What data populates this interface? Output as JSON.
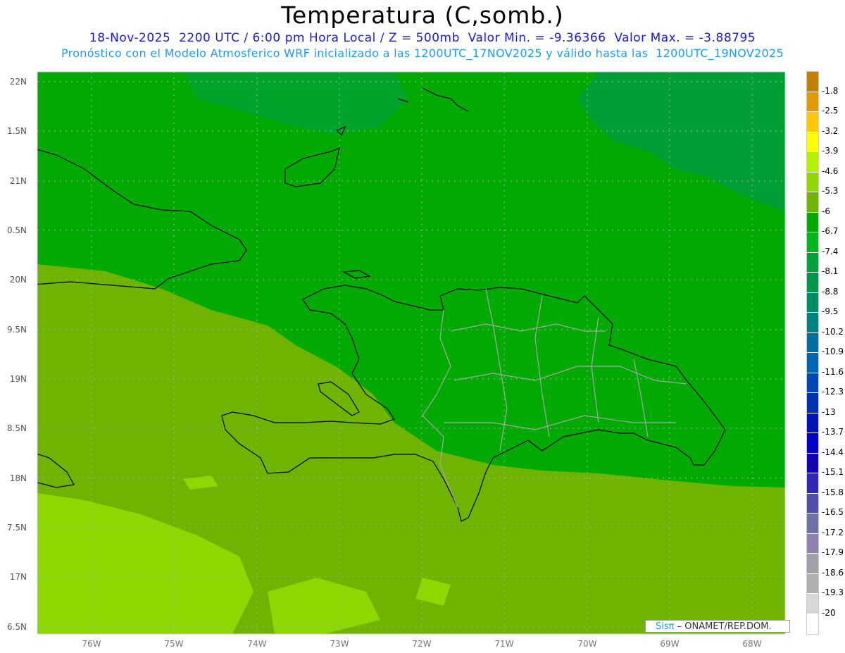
{
  "title": "Temperatura (C,somb.)",
  "subtitle_line1": "18-Nov-2025  2200 UTC / 6:00 pm Hora Local / Z = 500mb  Valor Min. = -9.36366  Valor Max. = -3.88795",
  "subtitle_line2": "Pronóstico con el Modelo Atmosferico WRF inicializado a las 1200UTC_17NOV2025 y válido hasta las  1200UTC_19NOV2025",
  "lat_labels": [
    "22N",
    "1.5N",
    "21N",
    "0.5N",
    "20N",
    "9.5N",
    "19N",
    "8.5N",
    "18N",
    "7.5N",
    "17N",
    "6.5N"
  ],
  "lon_labels": [
    "76W",
    "75W",
    "74W",
    "73W",
    "72W",
    "71W",
    "70W",
    "69W",
    "68W"
  ],
  "colorbar": {
    "labels": [
      "-1.8",
      "-2.5",
      "-3.2",
      "-3.9",
      "-4.6",
      "-5.3",
      "-6",
      "-6.7",
      "-7.4",
      "-8.1",
      "-8.8",
      "-9.5",
      "-10.2",
      "-10.9",
      "-11.6",
      "-12.3",
      "-13",
      "-13.7",
      "-14.4",
      "-15.1",
      "-15.8",
      "-16.5",
      "-17.2",
      "-17.9",
      "-18.6",
      "-19.3",
      "-20"
    ],
    "colors": [
      "#c08000",
      "#e09a00",
      "#ffc800",
      "#ffff00",
      "#b4f000",
      "#8cd800",
      "#6eb400",
      "#00aa00",
      "#00b41e",
      "#00a03c",
      "#00964b",
      "#008c64",
      "#008282",
      "#006ea0",
      "#0064b4",
      "#0046b4",
      "#0032b4",
      "#0014b4",
      "#0000c8",
      "#1400b4",
      "#3228b4",
      "#5050aa",
      "#7070aa",
      "#9080b0",
      "#a0a0a8",
      "#b0b0b0",
      "#d8d8d8",
      "#ffffff"
    ]
  },
  "logo": {
    "brand": "Sisπ",
    "text": " – ONAMET/REP.DOM."
  }
}
